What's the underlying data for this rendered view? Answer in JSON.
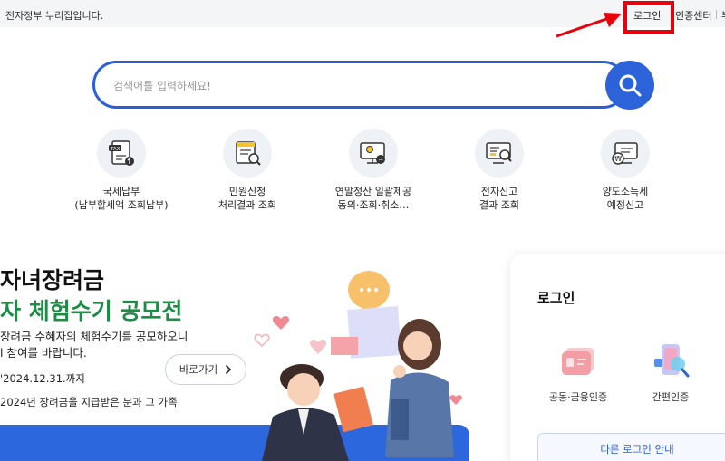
{
  "gov_bar": {
    "text": "전자정부 누리집입니다."
  },
  "top_menu": {
    "login": "로그인",
    "cert_center": "인증센터",
    "more": "부"
  },
  "search": {
    "placeholder": "검색어를 입력하세요!",
    "value": ""
  },
  "quick_menu": [
    {
      "line1": "국세납부",
      "line2": "(납부할세액 조회납부)",
      "icon": "tax-document-icon"
    },
    {
      "line1": "민원신청",
      "line2": "처리결과 조회",
      "icon": "certificate-search-icon"
    },
    {
      "line1": "연말정산 일괄제공",
      "line2": "동의·조회·취소…",
      "icon": "monitor-settlement-icon"
    },
    {
      "line1": "전자신고",
      "line2": "결과 조회",
      "icon": "report-search-icon"
    },
    {
      "line1": "양도소득세",
      "line2": "예정신고",
      "icon": "monitor-won-icon"
    }
  ],
  "banner": {
    "title_line1": "자녀장려금",
    "title_line2": "자 체험수기 공모전",
    "desc_line1": "장려금 수혜자의 체험수기를 공모하오니",
    "desc_line2": "l 참여를 바랍니다.",
    "date": "'2024.12.31.까지",
    "target": "2024년 장려금을 지급받은 분과 그 가족",
    "goto_label": "바로가기"
  },
  "login_card": {
    "title": "로그인",
    "options": [
      {
        "label": "공동·금융인증",
        "icon": "certificate-card-icon"
      },
      {
        "label": "간편인증",
        "icon": "phone-search-icon"
      }
    ],
    "other_login": "다른 로그인 안내"
  },
  "colors": {
    "primary_blue": "#2d63d9",
    "banner_green": "#1d8d45",
    "annotation_red": "#e8000b"
  }
}
